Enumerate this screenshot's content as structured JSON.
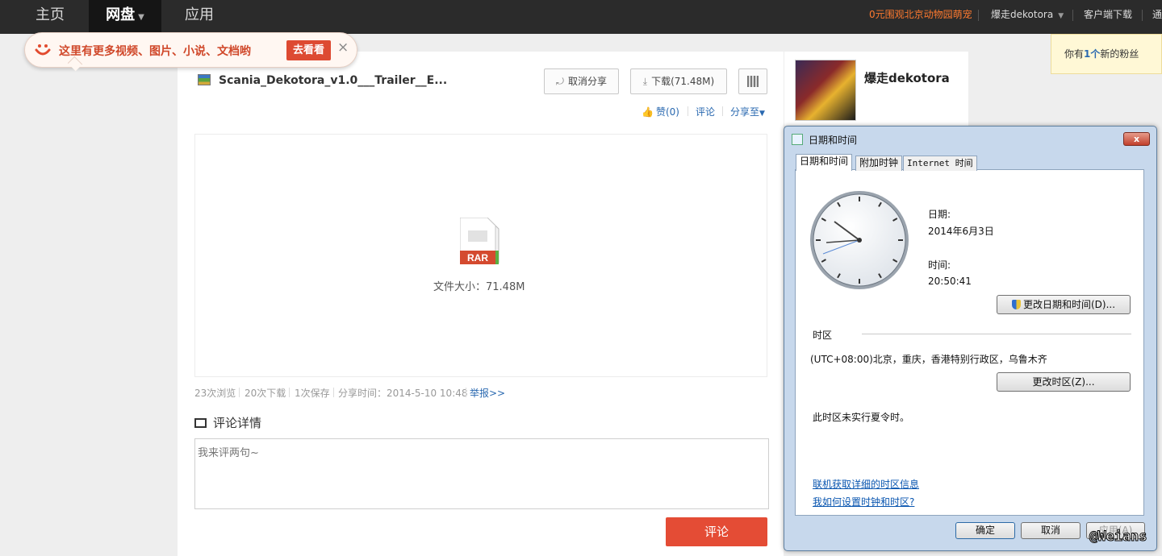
{
  "nav": {
    "home": "主页",
    "disk": "网盘",
    "apps": "应用"
  },
  "topright": {
    "promo": "0元围观北京动物园萌宠",
    "user": "爆走dekotora",
    "client": "客户端下载",
    "more": "通"
  },
  "bubble": {
    "text": "这里有更多视频、图片、小说、文档哟",
    "button": "去看看",
    "close": "×"
  },
  "file": {
    "title": "Scania_Dekotora_v1.0___Trailer__E...",
    "unshare": "取消分享",
    "download": "下载(71.48M)",
    "like": "赞(0)",
    "comment": "评论",
    "share_to": "分享至",
    "rar_label": "RAR",
    "size": "文件大小：71.48M"
  },
  "stats": {
    "views": "23次浏览",
    "downloads": "20次下载",
    "saves": "1次保存",
    "share_time": "分享时间：2014-5-10 10:48",
    "report": "举报>>"
  },
  "comments": {
    "heading": "评论详情",
    "placeholder": "我来评两句~",
    "submit": "评论"
  },
  "user_card": {
    "name": "爆走dekotora"
  },
  "fans_note": {
    "prefix": "你有",
    "count": "1个",
    "suffix": "新的粉丝"
  },
  "dialog": {
    "title": "日期和时间",
    "tabs": [
      "日期和时间",
      "附加时钟",
      "Internet 时间"
    ],
    "date_label": "日期:",
    "date_value": "2014年6月3日",
    "time_label": "时间:",
    "time_value": "20:50:41",
    "change_datetime": "更改日期和时间(D)...",
    "timezone_heading": "时区",
    "timezone_value": "(UTC+08:00)北京，重庆，香港特别行政区，乌鲁木齐",
    "change_timezone": "更改时区(Z)...",
    "dst_note": "此时区未实行夏令时。",
    "link_tz_info": "联机获取详细的时区信息",
    "link_howto": "我如何设置时钟和时区?",
    "ok": "确定",
    "cancel": "取消",
    "apply": "应用(A)",
    "close": "x"
  },
  "watermark": "@Weians"
}
